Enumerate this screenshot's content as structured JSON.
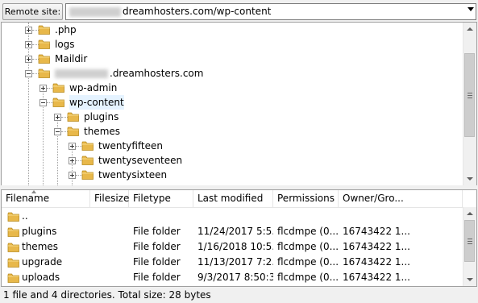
{
  "remote": {
    "label": "Remote site:",
    "path": "dreamhosters.com/wp-content"
  },
  "tree": {
    "items": [
      {
        "label": ".php"
      },
      {
        "label": "logs"
      },
      {
        "label": "Maildir"
      },
      {
        "label": ".dreamhosters.com"
      },
      {
        "label": "wp-admin"
      },
      {
        "label": "wp-content"
      },
      {
        "label": "plugins"
      },
      {
        "label": "themes"
      },
      {
        "label": "twentyfifteen"
      },
      {
        "label": "twentyseventeen"
      },
      {
        "label": "twentysixteen"
      }
    ]
  },
  "list": {
    "headers": [
      "Filename",
      "Filesize",
      "Filetype",
      "Last modified",
      "Permissions",
      "Owner/Gro..."
    ],
    "rows": [
      {
        "name": "..",
        "size": "",
        "type": "",
        "modified": "",
        "perms": "",
        "owner": ""
      },
      {
        "name": "plugins",
        "size": "",
        "type": "File folder",
        "modified": "11/24/2017 5:5...",
        "perms": "flcdmpe (0...",
        "owner": "16743422 1..."
      },
      {
        "name": "themes",
        "size": "",
        "type": "File folder",
        "modified": "1/16/2018 10:5...",
        "perms": "flcdmpe (0...",
        "owner": "16743422 1..."
      },
      {
        "name": "upgrade",
        "size": "",
        "type": "File folder",
        "modified": "11/13/2017 7:2...",
        "perms": "flcdmpe (0...",
        "owner": "16743422 1..."
      },
      {
        "name": "uploads",
        "size": "",
        "type": "File folder",
        "modified": "9/3/2017 8:50:3...",
        "perms": "flcdmpe (0...",
        "owner": "16743422 1..."
      }
    ]
  },
  "status": {
    "text": "1 file and 4 directories. Total size: 28 bytes"
  },
  "icons": {
    "folder": "folder-icon",
    "expand": "expand-toggle-icon",
    "dropdown": "chevron-down-icon"
  },
  "colors": {
    "folder": "#e8b84a",
    "selection": "#e5f3ff"
  }
}
